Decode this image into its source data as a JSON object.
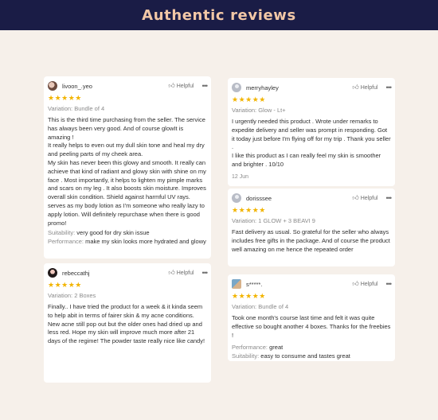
{
  "header": {
    "title": "Authentic reviews"
  },
  "helpful_label": "Helpful",
  "reviews": [
    {
      "user": "livoon_.yeo",
      "avatar": "user-photo",
      "stars": "★★★★★",
      "rating": 5,
      "variation": "Variation: Bundle of 4",
      "text": "This is the third time purchasing from the seller. The service has always been very good. And of course glowIt is amazing !\nIt really helps to even out my dull skin tone and heal my dry and peeling parts of my cheek area.\nMy skin has never been this glowy and smooth. It really can achieve that kind of radiant and glowy skin with shine on my face . Most importantly, it helps to lighten my pimple marks and scars on my leg . It also boosts skin moisture. Improves overall skin condition. Shield against harmful UV rays. serves as my body lotion as I'm someone who really lazy to apply lotion. Will definitely repurchase when there is good promo!",
      "suitability_label": "Suitability:",
      "suitability": "very good for dry skin issue",
      "performance_label": "Performance:",
      "performance": "make my skin looks more hydrated and glowy"
    },
    {
      "user": "rebeccathj",
      "avatar": "user-photo",
      "stars": "★★★★★",
      "rating": 5,
      "variation": "Variation: 2 Boxes",
      "text": "Finally.. I have tried the product for a week & it kinda seem to help abit in terms of fairer skin & my acne conditions. New acne still pop out but the older ones had dried up and less red. Hope my skin will improve much more after 21 days of the regime!  The powder taste really nice like candy!"
    },
    {
      "user": "merryhayley",
      "avatar": "default-avatar",
      "stars": "★★★★★",
      "rating": 5,
      "variation": "Variation: Glow - Lt+",
      "text": "I urgently needed this product . Wrote under remarks to expedite delivery and seller was prompt in responding. Got it today just before I'm flying off for my trip . Thank you seller .\nI like this product as I can really feel my skin is smoother and brighter . 10/10",
      "date": "12 Jun"
    },
    {
      "user": "dorisssee",
      "avatar": "default-avatar",
      "stars": "★★★★★",
      "rating": 5,
      "variation": "Variation: 1 GLOW + 3 BEAVI 9",
      "text": "Fast delivery as usual. So grateful for the seller who always includes free gifts in the package.  And of course the product well amazing on me hence the repeated order"
    },
    {
      "user": "s*****.",
      "avatar": "user-photo",
      "stars": "★★★★★",
      "rating": 5,
      "variation": "Variation: Bundle of 4",
      "text": "Took one month's course last time and felt it was quite effective so bought another 4 boxes. Thanks for the freebies !",
      "performance_label": "Performance:",
      "performance": "great",
      "suitability_label": "Suitability:",
      "suitability": "easy to consume and tastes great"
    }
  ],
  "colors": {
    "header_bg": "#1a1c46",
    "title": "#f2c7a6",
    "page_bg": "#f6f0ea",
    "star": "#f2b400"
  }
}
